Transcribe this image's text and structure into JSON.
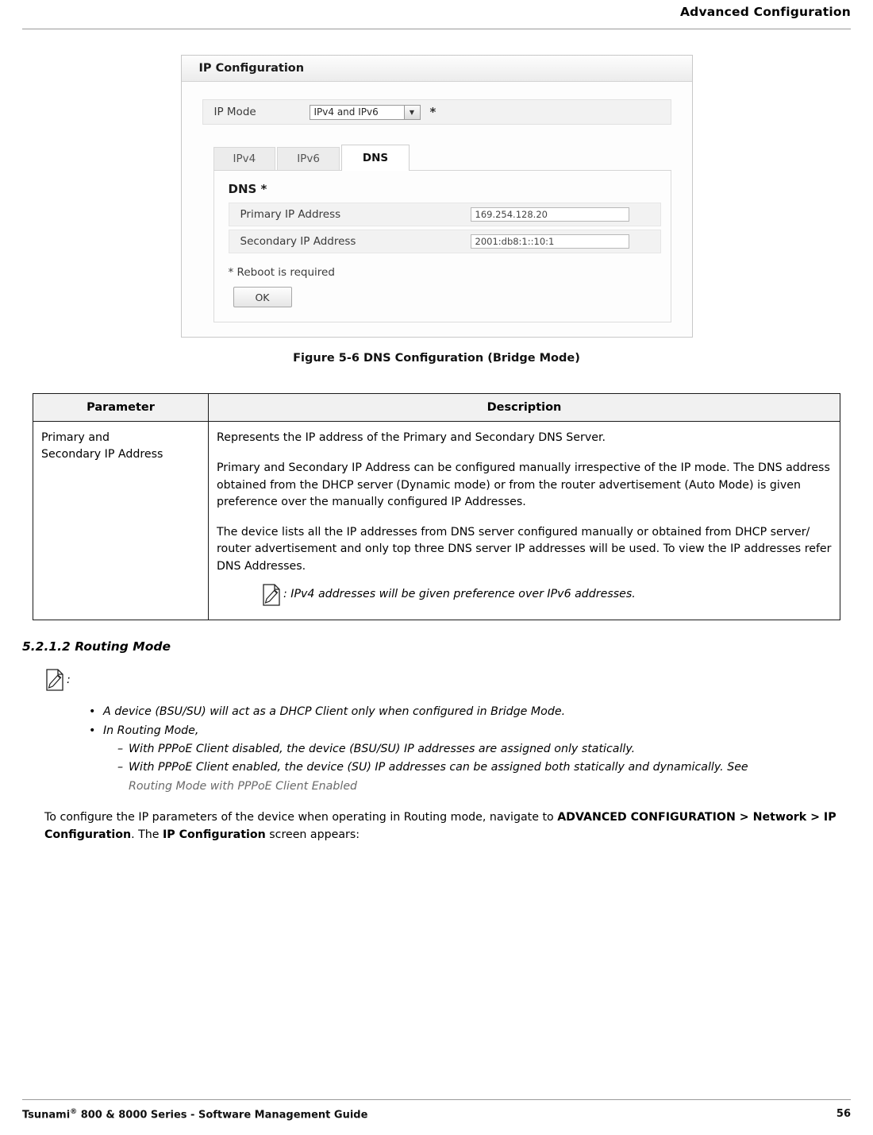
{
  "header": {
    "title": "Advanced Configuration"
  },
  "figure": {
    "caption": "Figure 5-6 DNS Configuration (Bridge Mode)",
    "screenshot": {
      "window_title": "IP Configuration",
      "ip_mode_label": "IP Mode",
      "ip_mode_value": "IPv4 and IPv6",
      "ip_mode_required_marker": "*",
      "tabs": [
        {
          "label": "IPv4",
          "active": false
        },
        {
          "label": "IPv6",
          "active": false
        },
        {
          "label": "DNS",
          "active": true
        }
      ],
      "panel_title": "DNS *",
      "fields": [
        {
          "label": "Primary IP Address",
          "value": "169.254.128.20"
        },
        {
          "label": "Secondary IP Address",
          "value": "2001:db8:1::10:1"
        }
      ],
      "reboot_note": "* Reboot is required",
      "ok_button": "OK"
    }
  },
  "table": {
    "headers": {
      "parameter": "Parameter",
      "description": "Description"
    },
    "rows": [
      {
        "parameter_line1": "Primary and",
        "parameter_line2": "Secondary IP Address",
        "description_paragraphs": [
          "Represents the IP address of the Primary and Secondary DNS Server.",
          "Primary and Secondary IP Address can be configured manually irrespective of the IP mode. The DNS address obtained from the DHCP server (Dynamic mode) or from the router advertisement (Auto Mode) is given preference over the manually configured IP Addresses.",
          "The device lists all the IP addresses from DNS server configured manually or obtained from DHCP server/ router advertisement and only top three DNS server IP addresses will be used. To view the IP addresses refer DNS Addresses."
        ],
        "note": ": IPv4 addresses will be given preference over IPv6 addresses."
      }
    ]
  },
  "section": {
    "heading": "5.2.1.2 Routing Mode",
    "note_colon": ":",
    "bullets": [
      "A device (BSU/SU) will act as a DHCP Client only when configured in Bridge Mode.",
      "In Routing Mode,"
    ],
    "sub_bullets": [
      {
        "text": "With PPPoE Client disabled, the device (BSU/SU) IP addresses are assigned only statically.",
        "link": ""
      },
      {
        "text": "With PPPoE Client enabled, the device (SU) IP addresses can be assigned both statically and dynamically. See ",
        "link": "Routing Mode with PPPoE Client Enabled"
      }
    ],
    "paragraph": {
      "part1": "To configure the IP parameters of the device when operating in Routing mode, navigate to ",
      "bold1": "ADVANCED CONFIGURATION > Network > IP Configuration",
      "part2": ". The ",
      "bold2": "IP Configuration",
      "part3": " screen appears:"
    }
  },
  "footer": {
    "left_pre": "Tsunami",
    "left_sup": "®",
    "left_post": " 800 & 8000 Series - Software Management Guide",
    "page_number": "56"
  }
}
